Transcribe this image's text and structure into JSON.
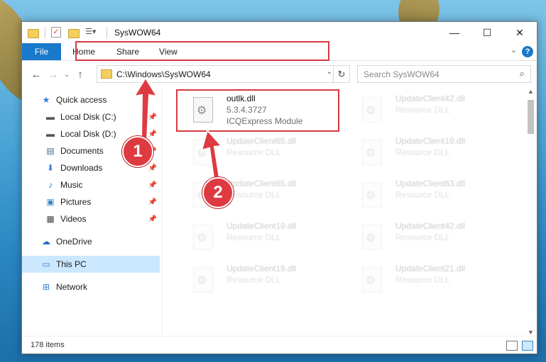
{
  "window": {
    "title": "SysWOW64",
    "controls": [
      "—",
      "☐",
      "✕"
    ]
  },
  "ribbon": {
    "file_label": "File",
    "tabs": [
      "Home",
      "Share",
      "View"
    ],
    "help_label": "?"
  },
  "address": {
    "path": "C:\\Windows\\SysWOW64"
  },
  "search": {
    "placeholder": "Search SysWOW64"
  },
  "sidebar": {
    "items": [
      {
        "label": "Quick access",
        "icon": "star-icon"
      },
      {
        "label": "Local Disk (C:)",
        "icon": "drive-icon",
        "pinned": true
      },
      {
        "label": "Local Disk (D:)",
        "icon": "drive-icon",
        "pinned": true
      },
      {
        "label": "Documents",
        "icon": "documents-icon",
        "pinned": true
      },
      {
        "label": "Downloads",
        "icon": "downloads-icon",
        "pinned": true
      },
      {
        "label": "Music",
        "icon": "music-icon",
        "pinned": true
      },
      {
        "label": "Pictures",
        "icon": "pictures-icon",
        "pinned": true
      },
      {
        "label": "Videos",
        "icon": "videos-icon",
        "pinned": true
      },
      {
        "label": "OneDrive",
        "icon": "onedrive-icon"
      },
      {
        "label": "This PC",
        "icon": "this-pc-icon",
        "selected": true
      },
      {
        "label": "Network",
        "icon": "network-icon"
      }
    ]
  },
  "files": [
    {
      "name": "outlk.dll",
      "line2": "5.3.4.3727",
      "line3": "ICQExpress Module"
    },
    {
      "name": "UpdateClient42.dll",
      "line2": "Resource DLL"
    },
    {
      "name": "UpdateClient65.dll",
      "line2": "Resource DLL"
    },
    {
      "name": "UpdateClient19.dll",
      "line2": "Resource DLL"
    },
    {
      "name": "UpdateClient65.dll",
      "line2": "Resource DLL"
    },
    {
      "name": "UpdateClient63.dll",
      "line2": "Resource DLL"
    },
    {
      "name": "UpdateClient19.dll",
      "line2": "Resource DLL"
    },
    {
      "name": "UpdateClient42.dll",
      "line2": "Resource DLL"
    },
    {
      "name": "UpdateClient19.dll",
      "line2": "Resource DLL"
    },
    {
      "name": "UpdateClient21.dll",
      "line2": "Resource DLL"
    }
  ],
  "status": {
    "items_count": "178 items"
  },
  "annotations": {
    "badge1": "1",
    "badge2": "2",
    "highlight_color": "#d9383f"
  },
  "colors": {
    "accent": "#1979ca",
    "selection": "#cce8ff"
  }
}
